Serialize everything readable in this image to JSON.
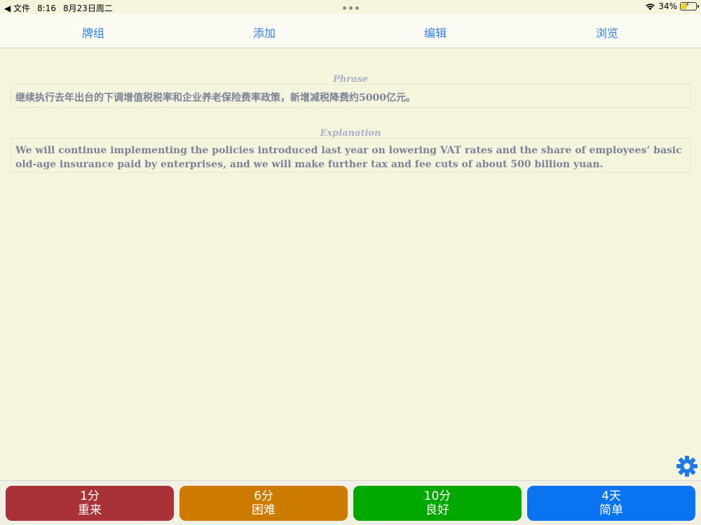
{
  "status": {
    "back_label": "◀ 文件",
    "time": "8:16",
    "date": "8月23日周二",
    "battery": "34%",
    "battery_level": 0.34
  },
  "nav": {
    "items": [
      {
        "label": "牌组"
      },
      {
        "label": "添加"
      },
      {
        "label": "编辑"
      },
      {
        "label": "浏览"
      }
    ]
  },
  "card": {
    "phrase_label": "Phrase",
    "phrase_text": "继续执行去年出台的下调增值税税率和企业养老保险费率政策，新增减税降费约5000亿元。",
    "explanation_label": "Explanation",
    "explanation_text": "We will continue implementing the policies introduced last year on lowering VAT rates and the share of employees’ basic old-age insurance paid by enterprises, and we will make further tax and fee cuts of about 500 billion yuan."
  },
  "answers": [
    {
      "interval": "1分",
      "label": "重来",
      "color": "#a83237"
    },
    {
      "interval": "6分",
      "label": "困难",
      "color": "#cc7a00"
    },
    {
      "interval": "10分",
      "label": "良好",
      "color": "#00a800"
    },
    {
      "interval": "4天",
      "label": "简单",
      "color": "#0a74f0"
    }
  ],
  "icons": {
    "settings": "gear-icon",
    "wifi": "wifi-icon"
  },
  "colors": {
    "accent": "#2f7fe6",
    "background": "#f5f4dc"
  }
}
